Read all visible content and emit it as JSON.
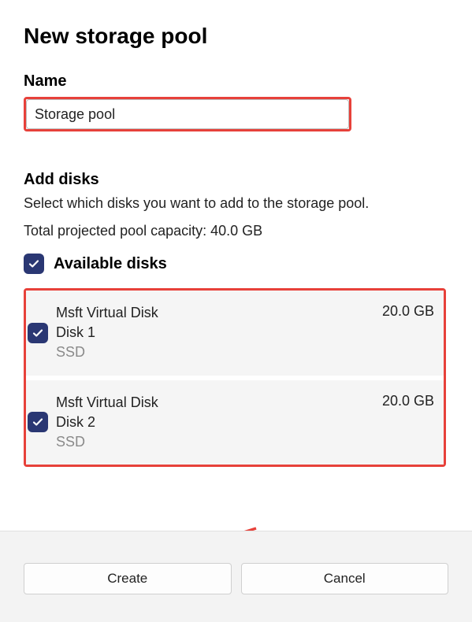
{
  "page_title": "New storage pool",
  "name_section": {
    "label": "Name",
    "value": "Storage pool"
  },
  "add_disks": {
    "heading": "Add disks",
    "description": "Select which disks you want to add to the storage pool.",
    "capacity_text": "Total projected pool capacity: 40.0 GB",
    "available_label": "Available disks",
    "available_checked": true,
    "disks": [
      {
        "model": "Msft Virtual Disk",
        "name": "Disk 1",
        "type": "SSD",
        "size": "20.0 GB",
        "checked": true
      },
      {
        "model": "Msft Virtual Disk",
        "name": "Disk 2",
        "type": "SSD",
        "size": "20.0 GB",
        "checked": true
      }
    ]
  },
  "footer": {
    "create_label": "Create",
    "cancel_label": "Cancel"
  },
  "highlight_color": "#e7413a",
  "accent_color": "#2a3773"
}
